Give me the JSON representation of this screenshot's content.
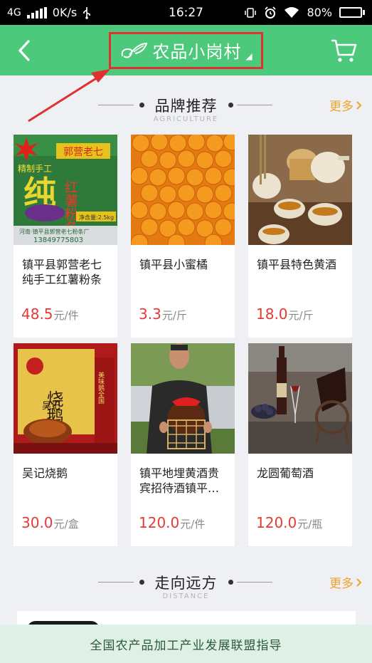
{
  "status_bar": {
    "network": "4G",
    "speed": "0K/s",
    "time": "16:27",
    "battery": "80%",
    "battery_level": 0.8
  },
  "header": {
    "title": "农品小岗村",
    "back_icon": "chevron-left-icon",
    "cart_icon": "cart-icon",
    "background": "#4cc97a",
    "highlight_color": "#e0302f"
  },
  "sections": [
    {
      "title": "品牌推荐",
      "subtitle": "AGRICULTURE",
      "more": "更多"
    },
    {
      "title": "走向远方",
      "subtitle": "DISTANCE",
      "more": "更多"
    }
  ],
  "products": [
    {
      "name": "镇平县郭营老七纯手工红薯粉条",
      "price": "48.5",
      "unit": "元/件"
    },
    {
      "name": "镇平县小蜜橘",
      "price": "3.3",
      "unit": "元/斤"
    },
    {
      "name": "镇平县特色黄酒",
      "price": "18.0",
      "unit": "元/斤"
    },
    {
      "name": "吴记烧鹅",
      "price": "30.0",
      "unit": "元/盒"
    },
    {
      "name": "镇平地埋黄酒贵宾招待酒镇平云平…",
      "price": "120.0",
      "unit": "元/件"
    },
    {
      "name": "龙圆葡萄酒",
      "price": "120.0",
      "unit": "元/瓶"
    }
  ],
  "product_images": {
    "p1": {
      "brand": "郭营老七",
      "tag": "精制手工",
      "big": "纯",
      "words": "红薯粉条",
      "sub": "净含量:2.5kg",
      "bottom1": "河南·镇平县郭营老七粉条厂",
      "bottom2": "13849775803"
    },
    "p4": {
      "brand": "吴记",
      "words": "烧鹅",
      "side": "美味鹅全国"
    }
  },
  "footer": {
    "text": "全国农产品加工产业发展联盟指导"
  },
  "colors": {
    "price": "#e53935",
    "more": "#f0a22d",
    "accent_green": "#4cc97a"
  }
}
